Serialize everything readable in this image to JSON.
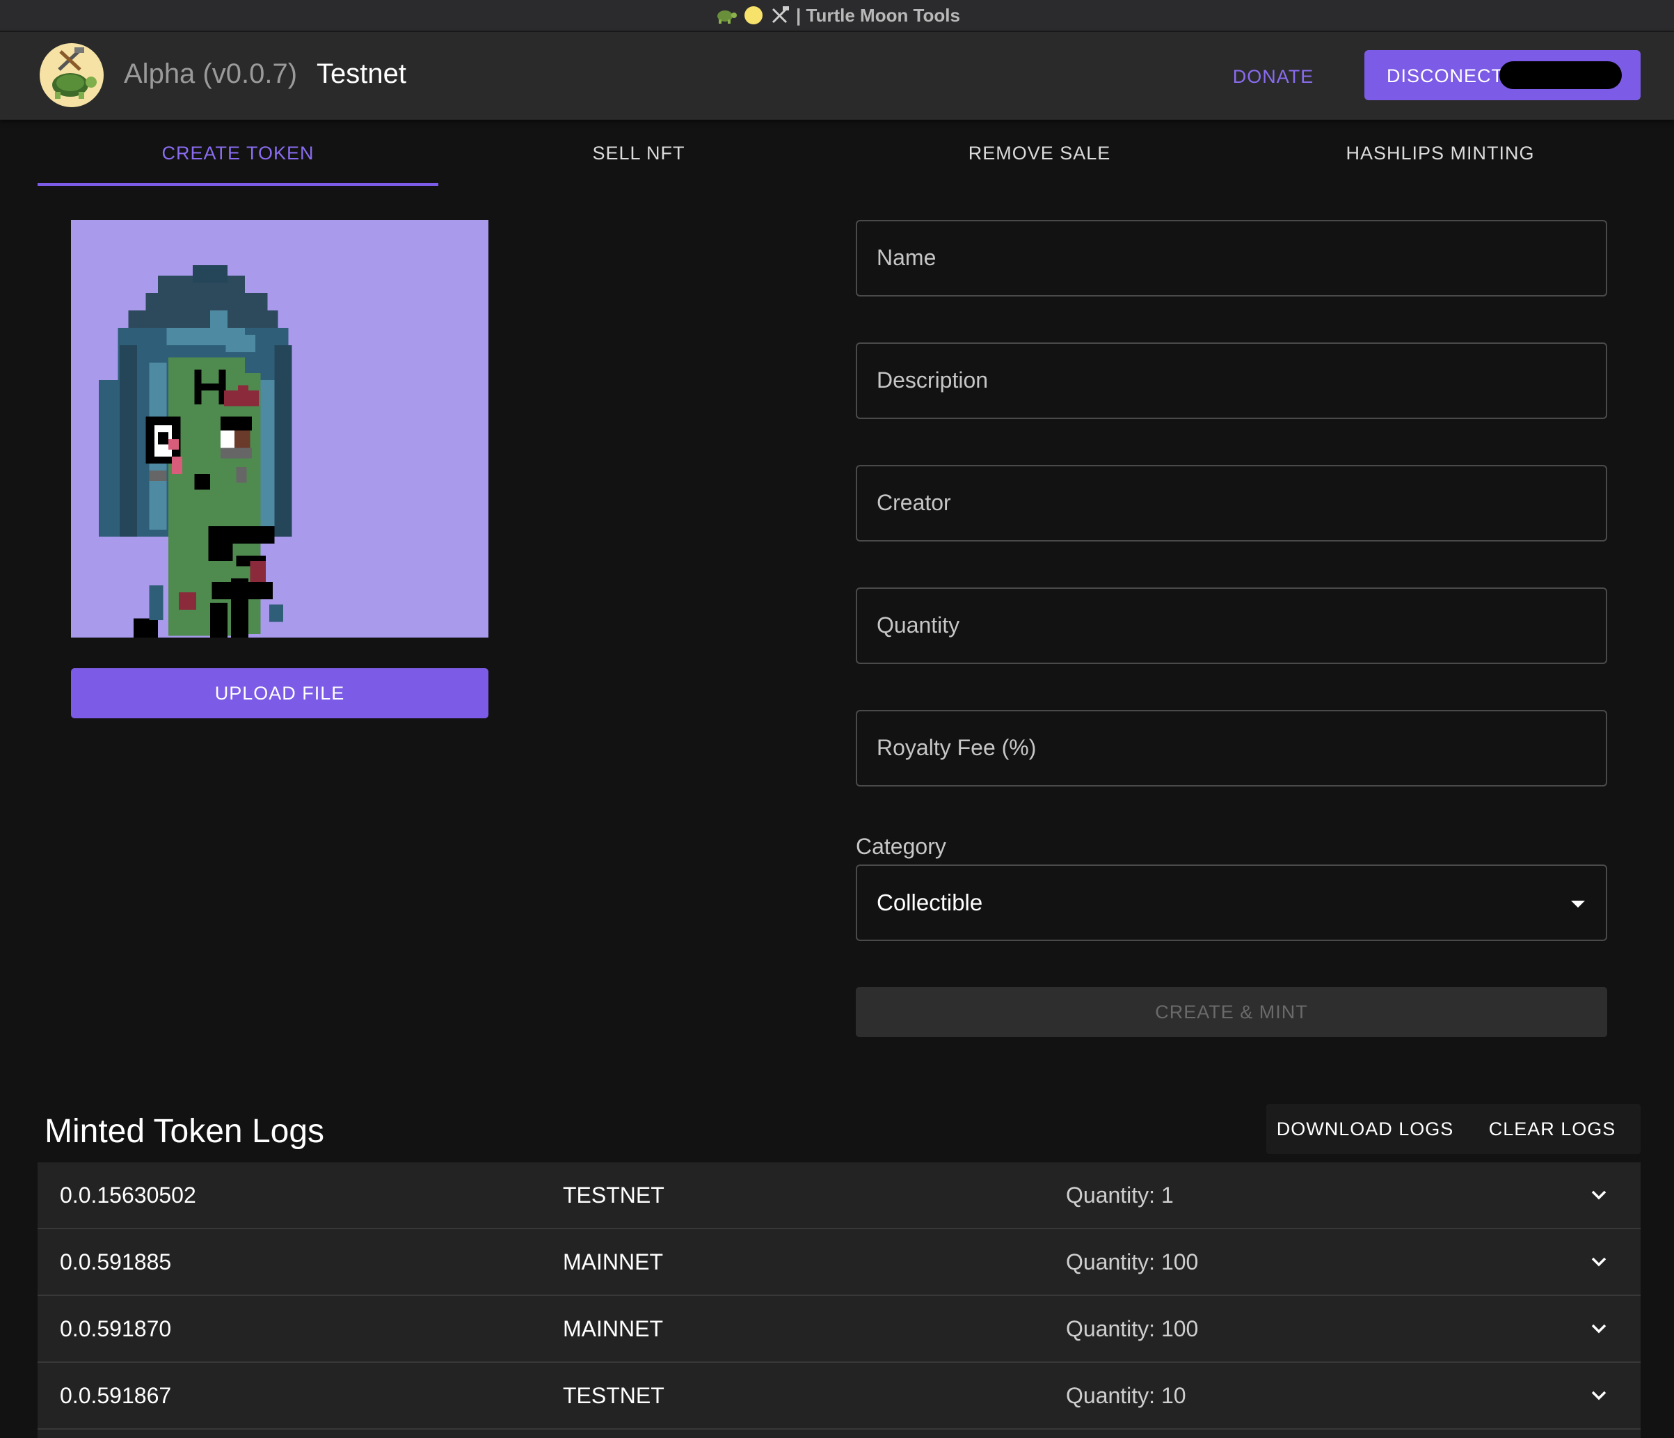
{
  "window": {
    "title": "| Turtle Moon Tools",
    "title_icons": [
      "turtle-icon",
      "moon-icon",
      "tools-icon"
    ]
  },
  "header": {
    "version": "Alpha (v0.0.7)",
    "network": "Testnet",
    "donate_label": "DONATE",
    "disconnect_label": "DISCONECT"
  },
  "tabs": [
    {
      "label": "CREATE TOKEN",
      "active": true
    },
    {
      "label": "SELL NFT",
      "active": false
    },
    {
      "label": "REMOVE SALE",
      "active": false
    },
    {
      "label": "HASHLIPS MINTING",
      "active": false
    }
  ],
  "upload": {
    "label": "UPLOAD FILE"
  },
  "form": {
    "fields": [
      {
        "placeholder": "Name",
        "value": ""
      },
      {
        "placeholder": "Description",
        "value": ""
      },
      {
        "placeholder": "Creator",
        "value": ""
      },
      {
        "placeholder": "Quantity",
        "value": ""
      },
      {
        "placeholder": "Royalty Fee (%)",
        "value": ""
      }
    ],
    "category_label": "Category",
    "category_value": "Collectible",
    "submit_label": "CREATE & MINT"
  },
  "logs": {
    "title": "Minted Token Logs",
    "download_label": "DOWNLOAD LOGS",
    "clear_label": "CLEAR LOGS",
    "rows": [
      {
        "token_id": "0.0.15630502",
        "network": "TESTNET",
        "quantity": "Quantity: 1"
      },
      {
        "token_id": "0.0.591885",
        "network": "MAINNET",
        "quantity": "Quantity: 100"
      },
      {
        "token_id": "0.0.591870",
        "network": "MAINNET",
        "quantity": "Quantity: 100"
      },
      {
        "token_id": "0.0.591867",
        "network": "TESTNET",
        "quantity": "Quantity: 10"
      }
    ]
  },
  "colors": {
    "accent": "#7c5ce6",
    "accent_text": "#8a6cf0",
    "background": "#121212",
    "surface": "#232323",
    "nft_bg": "#a99aec"
  }
}
